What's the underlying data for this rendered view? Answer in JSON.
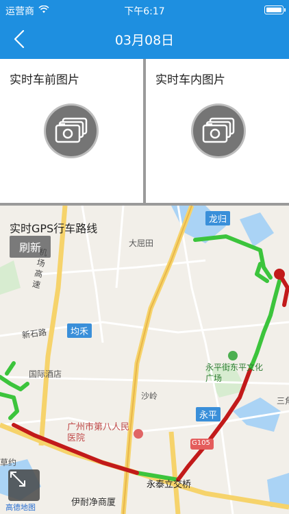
{
  "status": {
    "carrier": "运营商",
    "time": "下午6:17"
  },
  "nav": {
    "title": "03月08日"
  },
  "cards": {
    "front": {
      "label": "实时车前图片"
    },
    "inside": {
      "label": "实时车内图片"
    }
  },
  "map": {
    "title": "实时GPS行车路线",
    "refresh": "刷新",
    "labels": {
      "longgui": "龙归",
      "daqutian": "大屈田",
      "airport": "机场高速",
      "xinshi": "新石路",
      "junhe": "均禾",
      "hotel": "国际酒店",
      "shaling": "沙岭",
      "yongping_culture": "永平街东平文化广场",
      "yongping": "永平",
      "hospital": "广州市第八人民医院",
      "yongtai": "永泰立交桥",
      "yinai": "伊耐净商厦",
      "g105": "G105",
      "caoyue": "草约",
      "sanjiao": "三角",
      "gaozhen": "高德地图"
    }
  },
  "colors": {
    "header": "#1e8fe0",
    "track_green": "#3cc43c",
    "track_red": "#c21a1a"
  }
}
